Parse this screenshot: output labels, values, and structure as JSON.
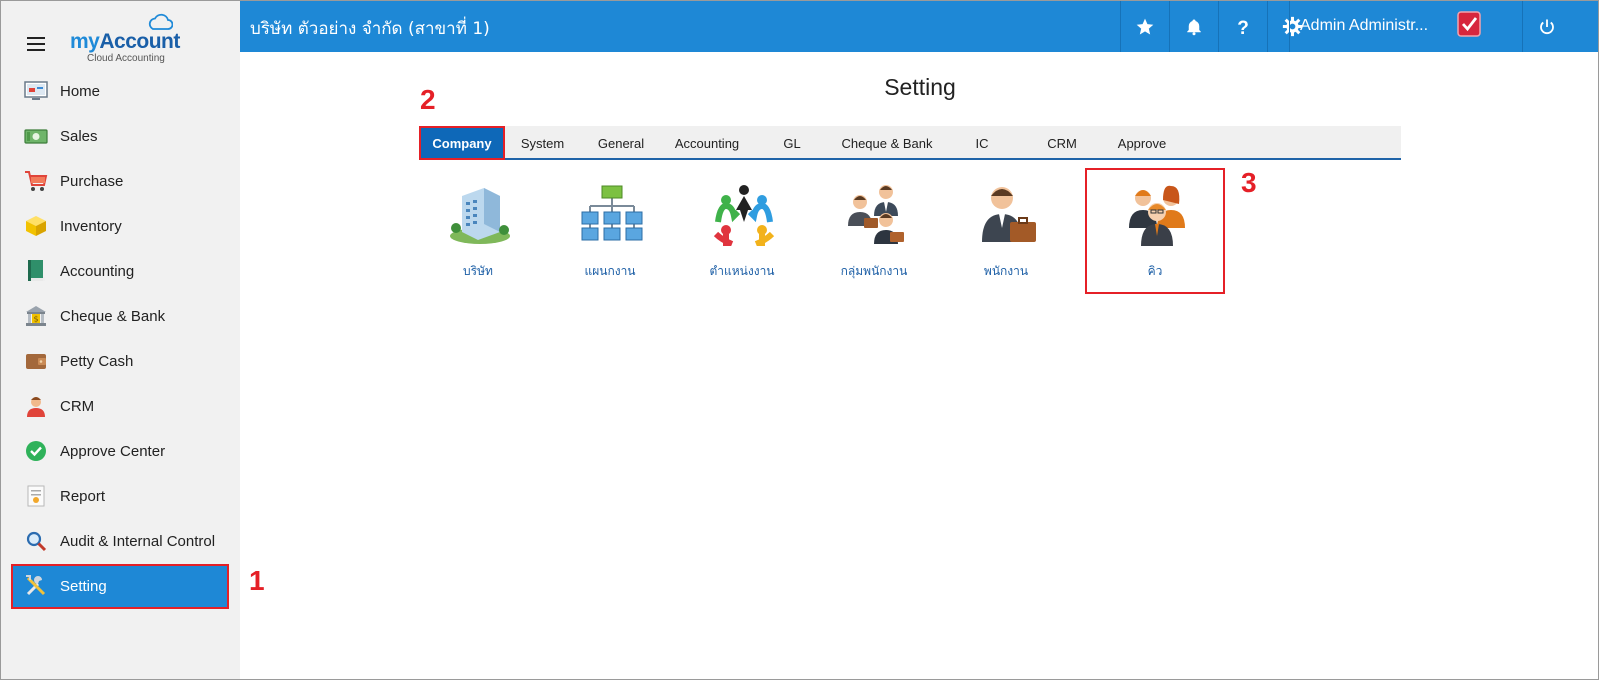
{
  "brand": {
    "name_my": "my",
    "name_account": "Account",
    "subtitle": "Cloud Accounting"
  },
  "sidebar": {
    "items": [
      {
        "label": "Home",
        "icon": "home-icon"
      },
      {
        "label": "Sales",
        "icon": "money-icon"
      },
      {
        "label": "Purchase",
        "icon": "cart-icon"
      },
      {
        "label": "Inventory",
        "icon": "box-icon"
      },
      {
        "label": "Accounting",
        "icon": "book-icon"
      },
      {
        "label": "Cheque & Bank",
        "icon": "bank-icon"
      },
      {
        "label": "Petty Cash",
        "icon": "wallet-icon"
      },
      {
        "label": "CRM",
        "icon": "person-icon"
      },
      {
        "label": "Approve Center",
        "icon": "check-circle-icon"
      },
      {
        "label": "Report",
        "icon": "report-icon"
      },
      {
        "label": "Audit & Internal Control",
        "icon": "magnifier-icon"
      },
      {
        "label": "Setting",
        "icon": "tools-icon",
        "active": true
      }
    ]
  },
  "topbar": {
    "company": "บริษัท ตัวอย่าง จำกัด (สาขาที่ 1)",
    "user": "Admin Administr...",
    "accent": "#1e88d6"
  },
  "main": {
    "title": "Setting",
    "tabs": [
      {
        "label": "Company",
        "active": true
      },
      {
        "label": "System"
      },
      {
        "label": "General"
      },
      {
        "label": "Accounting"
      },
      {
        "label": "GL"
      },
      {
        "label": "Cheque & Bank"
      },
      {
        "label": "IC"
      },
      {
        "label": "CRM"
      },
      {
        "label": "Approve"
      }
    ],
    "tiles": [
      {
        "label": "บริษัท",
        "icon": "building-icon"
      },
      {
        "label": "แผนกงาน",
        "icon": "org-chart-icon"
      },
      {
        "label": "ตำแหน่งงาน",
        "icon": "people-circle-icon"
      },
      {
        "label": "กลุ่มพนักงาน",
        "icon": "employee-group-icon"
      },
      {
        "label": "พนักงาน",
        "icon": "employee-icon"
      },
      {
        "label": "คิว",
        "icon": "queue-team-icon"
      }
    ]
  },
  "annotations": {
    "step1": "1",
    "step2": "2",
    "step3": "3",
    "highlight_color": "#e52027"
  }
}
